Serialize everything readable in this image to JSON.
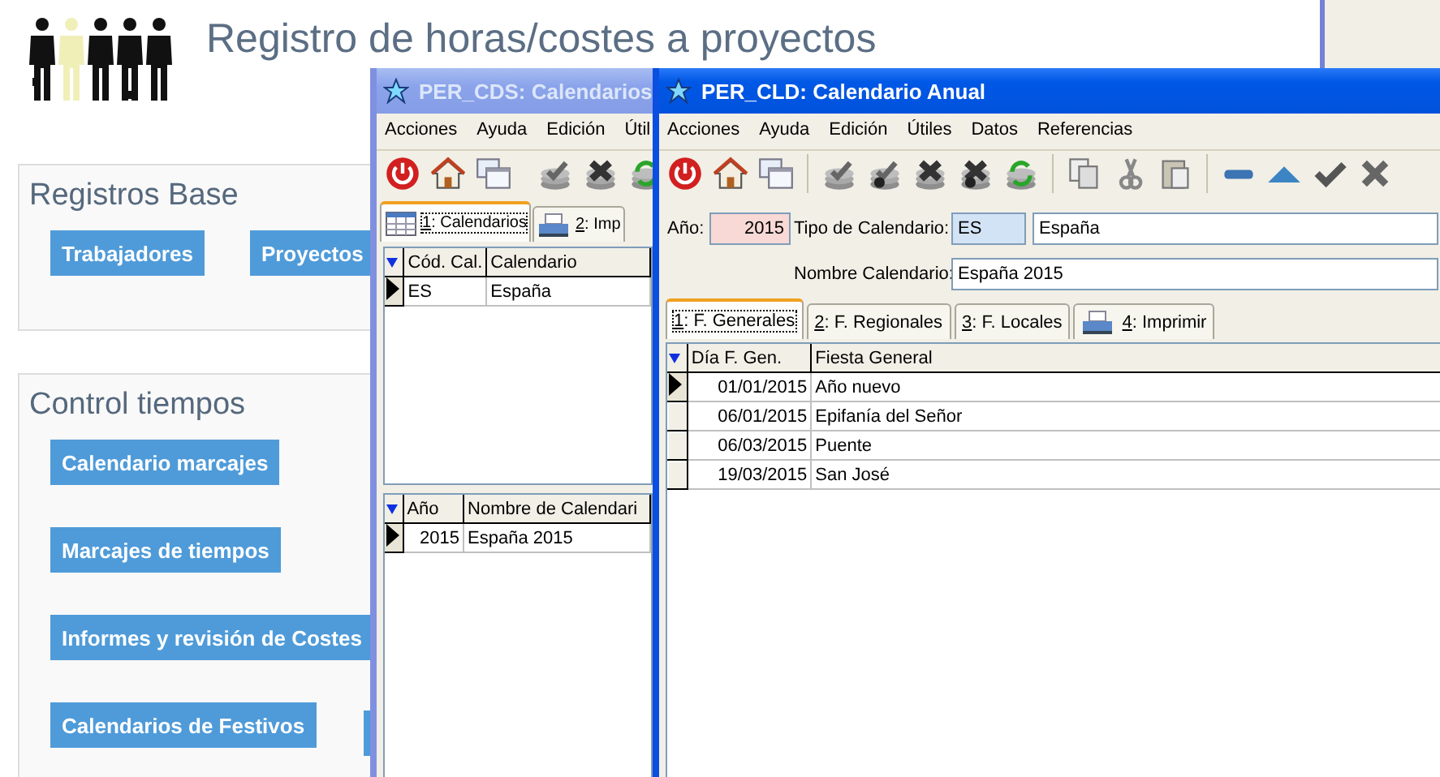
{
  "page": {
    "title": "Registro de horas/costes a proyectos",
    "sections": [
      {
        "title": "Registros Base",
        "buttons": [
          "Trabajadores",
          "Proyectos"
        ]
      },
      {
        "title": "Control tiempos",
        "buttons": [
          "Calendario marcajes",
          "Marcajes de tiempos",
          "Informes y revisión de Costes",
          "Calendarios de Festivos"
        ]
      }
    ]
  },
  "calendars_window": {
    "title": "PER_CDS: Calendarios",
    "active": false,
    "menu": [
      {
        "label": "Acciones"
      },
      {
        "label": "Ayuda"
      },
      {
        "label": "Edición"
      },
      {
        "label": "Útil"
      }
    ],
    "tabs": [
      {
        "label": "1: Calendarios",
        "selected": true,
        "kind": "grid"
      },
      {
        "label": "2: Imp",
        "selected": false,
        "kind": "print"
      }
    ],
    "calendar_grid": {
      "columns": [
        "Cód. Cal.",
        "Calendario"
      ],
      "rows": [
        {
          "cells": [
            "ES",
            "España"
          ],
          "current": true
        }
      ]
    },
    "year_grid": {
      "columns": [
        "Año",
        "Nombre de Calendari"
      ],
      "rows": [
        {
          "cells": [
            "2015",
            "España 2015"
          ],
          "current": true
        }
      ]
    }
  },
  "annual_window": {
    "title": "PER_CLD: Calendario Anual",
    "active": true,
    "menu": [
      {
        "label": "Acciones"
      },
      {
        "label": "Ayuda"
      },
      {
        "label": "Edición"
      },
      {
        "label": "Útiles"
      },
      {
        "label": "Datos"
      },
      {
        "label": "Referencias"
      }
    ],
    "year_label": "Año:",
    "year": "2015",
    "type_label": "Tipo de Calendario:",
    "type_code": "ES",
    "type_name": "España",
    "name_label": "Nombre Calendario:",
    "name": "España 2015",
    "tabs": [
      {
        "label": "1: F. Generales",
        "selected": true,
        "kind": "text"
      },
      {
        "label": "2: F. Regionales",
        "selected": false,
        "kind": "text"
      },
      {
        "label": "3: F. Locales",
        "selected": false,
        "kind": "text"
      },
      {
        "label": "4: Imprimir",
        "selected": false,
        "kind": "print"
      }
    ],
    "holiday_grid": {
      "columns": [
        "Día F. Gen.",
        "Fiesta General"
      ],
      "rows": [
        {
          "cells": [
            "01/01/2015",
            "Año nuevo"
          ],
          "current": true
        },
        {
          "cells": [
            "06/01/2015",
            "Epifanía del Señor"
          ],
          "current": false
        },
        {
          "cells": [
            "06/03/2015",
            "Puente"
          ],
          "current": false
        },
        {
          "cells": [
            "19/03/2015",
            "San José"
          ],
          "current": false
        }
      ]
    }
  }
}
